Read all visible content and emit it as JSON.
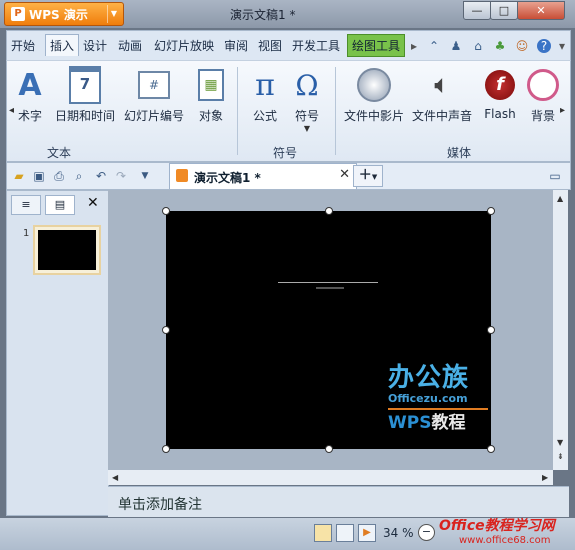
{
  "window": {
    "app_label": "WPS 演示",
    "doc_title": "演示文稿1 *",
    "controls": {
      "minimize": "—",
      "maximize": "□",
      "close": "✕"
    }
  },
  "ribbon_tabs": [
    {
      "label": "开始"
    },
    {
      "label": "插入"
    },
    {
      "label": "设计"
    },
    {
      "label": "动画"
    },
    {
      "label": "幻灯片放映"
    },
    {
      "label": "审阅"
    },
    {
      "label": "视图"
    },
    {
      "label": "开发工具"
    },
    {
      "label": "绘图工具"
    }
  ],
  "ribbon": {
    "groups": [
      {
        "label": "文本",
        "items": [
          {
            "label": "术字",
            "icon": "wordart-icon"
          },
          {
            "label": "日期和时间",
            "icon": "calendar-icon"
          },
          {
            "label": "幻灯片编号",
            "icon": "slide-number-icon"
          },
          {
            "label": "对象",
            "icon": "object-icon"
          }
        ]
      },
      {
        "label": "符号",
        "items": [
          {
            "label": "公式",
            "icon": "pi-icon",
            "glyph": "π"
          },
          {
            "label": "符号",
            "icon": "omega-icon",
            "glyph": "Ω"
          }
        ]
      },
      {
        "label": "媒体",
        "items": [
          {
            "label": "文件中影片",
            "icon": "film-icon"
          },
          {
            "label": "文件中声音",
            "icon": "speaker-icon"
          },
          {
            "label": "Flash",
            "icon": "flash-icon"
          },
          {
            "label": "背景",
            "icon": "background-icon"
          }
        ]
      }
    ]
  },
  "document_tab": {
    "name": "演示文稿1 *"
  },
  "slide_panel": {
    "thumbnail_number": "1"
  },
  "slide": {
    "watermark": {
      "brand_cn": "办公族",
      "url": "Officezu.com",
      "wps_prefix": "WPS",
      "wps_suffix": "教程"
    }
  },
  "notes": {
    "placeholder": "单击添加备注"
  },
  "status": {
    "zoom": "34 %"
  },
  "brand": {
    "line1": "Office教程学习网",
    "line2": "www.office68.com"
  },
  "colors": {
    "app_button": "#ef7d0c",
    "drawing_tools_tab": "#79c24a",
    "slide_background": "#000000",
    "watermark_blue": "#4ab0e6",
    "brand_red": "#d9231e"
  }
}
